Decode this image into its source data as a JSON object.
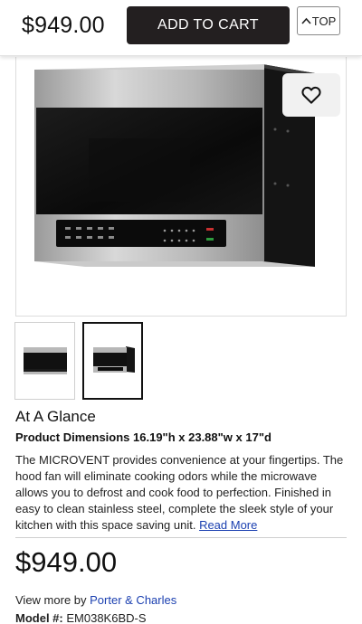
{
  "header": {
    "price": "$949.00",
    "add_to_cart": "ADD TO CART",
    "top_label": "TOP"
  },
  "gallery": {
    "favorite_icon": "heart-icon",
    "thumbnails": [
      "front view",
      "angled view"
    ],
    "selected_thumbnail": 2
  },
  "overview": {
    "heading": "At A Glance",
    "dimensions": "Product Dimensions 16.19\"h x 23.88\"w x 17\"d",
    "description": "The MICROVENT provides convenience at your fingertips. The hood fan will eliminate cooking odors while the microwave allows you to defrost and cook food to perfection. Finished in easy to clean stainless steel, complete the sleek style of your kitchen with this space saving unit.",
    "read_more": "Read More"
  },
  "pricing": {
    "price": "$949.00"
  },
  "brand": {
    "view_more_label": "View more by",
    "brand_name": "Porter & Charles"
  },
  "model": {
    "label": "Model #:",
    "number": "EM038K6BD-S"
  },
  "colors": {
    "cart_button_bg": "#231f20",
    "link": "#1a3fb0"
  }
}
